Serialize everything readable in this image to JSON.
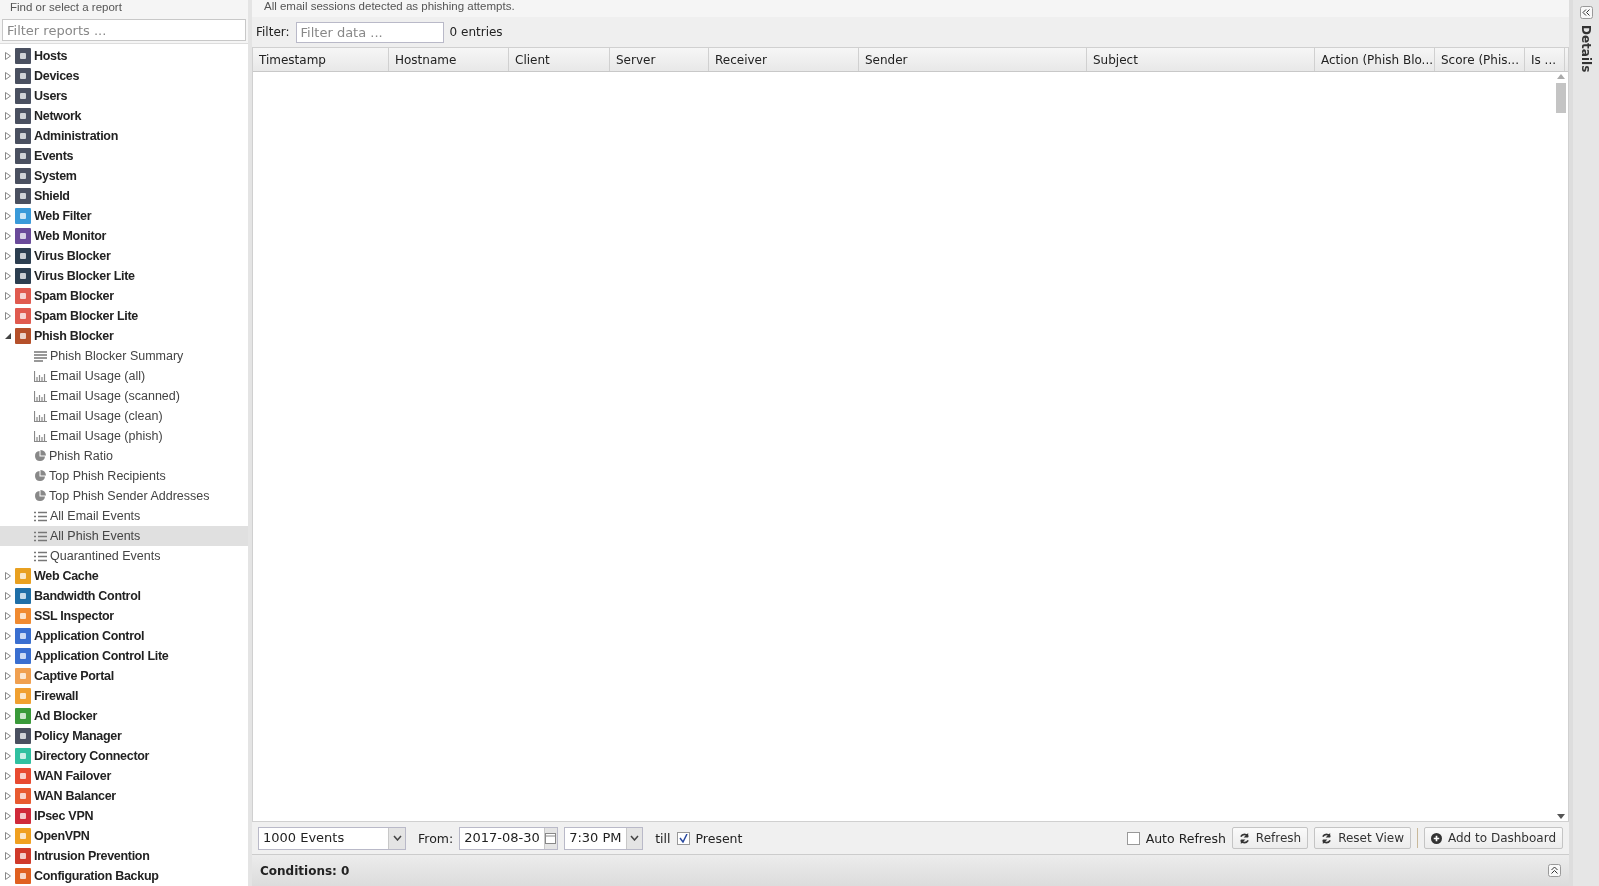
{
  "sidebar": {
    "title": "Find or select a report",
    "search": {
      "placeholder": "Filter reports ..."
    },
    "items": [
      {
        "label": "Hosts",
        "color": "#4a5060",
        "expanded": false,
        "selected": false
      },
      {
        "label": "Devices",
        "color": "#4a5060",
        "expanded": false,
        "selected": false
      },
      {
        "label": "Users",
        "color": "#4a5060",
        "expanded": false,
        "selected": false
      },
      {
        "label": "Network",
        "color": "#4a5060",
        "expanded": false,
        "selected": false
      },
      {
        "label": "Administration",
        "color": "#4a5060",
        "expanded": false,
        "selected": false
      },
      {
        "label": "Events",
        "color": "#4a5060",
        "expanded": false,
        "selected": false
      },
      {
        "label": "System",
        "color": "#4a5060",
        "expanded": false,
        "selected": false
      },
      {
        "label": "Shield",
        "color": "#4a5060",
        "expanded": false,
        "selected": false
      },
      {
        "label": "Web Filter",
        "color": "#3a9ad9",
        "expanded": false,
        "selected": false
      },
      {
        "label": "Web Monitor",
        "color": "#6a4a9a",
        "expanded": false,
        "selected": false
      },
      {
        "label": "Virus Blocker",
        "color": "#2c3e50",
        "expanded": false,
        "selected": false
      },
      {
        "label": "Virus Blocker Lite",
        "color": "#2c3e50",
        "expanded": false,
        "selected": false
      },
      {
        "label": "Spam Blocker",
        "color": "#e05a4f",
        "expanded": false,
        "selected": false
      },
      {
        "label": "Spam Blocker Lite",
        "color": "#e05a4f",
        "expanded": false,
        "selected": false
      },
      {
        "label": "Phish Blocker",
        "color": "#b5502a",
        "expanded": true,
        "selected": false,
        "children": [
          {
            "label": "Phish Blocker Summary",
            "kind": "text",
            "selected": false
          },
          {
            "label": "Email Usage (all)",
            "kind": "bar",
            "selected": false
          },
          {
            "label": "Email Usage (scanned)",
            "kind": "bar",
            "selected": false
          },
          {
            "label": "Email Usage (clean)",
            "kind": "bar",
            "selected": false
          },
          {
            "label": "Email Usage (phish)",
            "kind": "bar",
            "selected": false
          },
          {
            "label": "Phish Ratio",
            "kind": "pie",
            "selected": false
          },
          {
            "label": "Top Phish Recipients",
            "kind": "pie",
            "selected": false
          },
          {
            "label": "Top Phish Sender Addresses",
            "kind": "pie",
            "selected": false
          },
          {
            "label": "All Email Events",
            "kind": "list",
            "selected": false
          },
          {
            "label": "All Phish Events",
            "kind": "list",
            "selected": true
          },
          {
            "label": "Quarantined Events",
            "kind": "list",
            "selected": false
          }
        ]
      },
      {
        "label": "Web Cache",
        "color": "#e8a020",
        "expanded": false,
        "selected": false
      },
      {
        "label": "Bandwidth Control",
        "color": "#1f6fa8",
        "expanded": false,
        "selected": false
      },
      {
        "label": "SSL Inspector",
        "color": "#f08a30",
        "expanded": false,
        "selected": false
      },
      {
        "label": "Application Control",
        "color": "#3a6fd0",
        "expanded": false,
        "selected": false
      },
      {
        "label": "Application Control Lite",
        "color": "#3a6fd0",
        "expanded": false,
        "selected": false
      },
      {
        "label": "Captive Portal",
        "color": "#f0a050",
        "expanded": false,
        "selected": false
      },
      {
        "label": "Firewall",
        "color": "#f0a030",
        "expanded": false,
        "selected": false
      },
      {
        "label": "Ad Blocker",
        "color": "#3a9a3a",
        "expanded": false,
        "selected": false
      },
      {
        "label": "Policy Manager",
        "color": "#4a5060",
        "expanded": false,
        "selected": false
      },
      {
        "label": "Directory Connector",
        "color": "#30c0a0",
        "expanded": false,
        "selected": false
      },
      {
        "label": "WAN Failover",
        "color": "#e84a30",
        "expanded": false,
        "selected": false
      },
      {
        "label": "WAN Balancer",
        "color": "#e85a30",
        "expanded": false,
        "selected": false
      },
      {
        "label": "IPsec VPN",
        "color": "#d02a3a",
        "expanded": false,
        "selected": false
      },
      {
        "label": "OpenVPN",
        "color": "#f0a020",
        "expanded": false,
        "selected": false
      },
      {
        "label": "Intrusion Prevention",
        "color": "#d03a2a",
        "expanded": false,
        "selected": false
      },
      {
        "label": "Configuration Backup",
        "color": "#e06020",
        "expanded": false,
        "selected": false
      }
    ]
  },
  "report": {
    "description": "All email sessions detected as phishing attempts.",
    "filter": {
      "label": "Filter:",
      "placeholder": "Filter data ...",
      "count": "0 entries"
    },
    "table": {
      "columns": [
        "Timestamp",
        "Hostname",
        "Client",
        "Server",
        "Receiver",
        "Sender",
        "Subject",
        "Action (Phish Blo...",
        "Score (Phis...",
        "Is ..."
      ]
    },
    "toolbar": {
      "limit": "1000 Events",
      "from_label": "From:",
      "date": "2017-08-30",
      "time": "7:30 PM",
      "till": "till",
      "present": {
        "label": "Present",
        "checked": true
      },
      "auto_refresh": {
        "label": "Auto Refresh",
        "checked": false
      },
      "buttons": [
        "Refresh",
        "Reset View",
        "Add to Dashboard"
      ]
    },
    "conditions": "Conditions: 0"
  },
  "details": {
    "title": "Details"
  }
}
